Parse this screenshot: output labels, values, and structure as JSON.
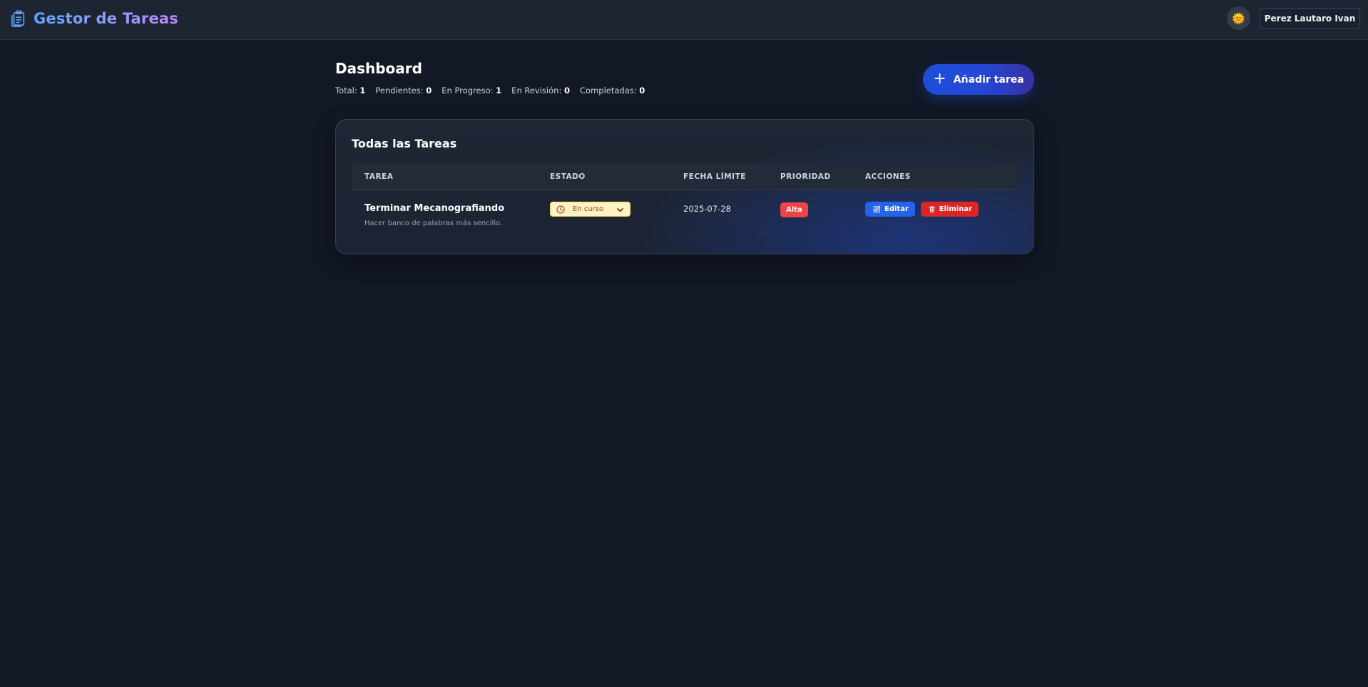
{
  "header": {
    "title": "Gestor de Tareas",
    "brand_icon": "clipboard-icon",
    "theme_icon": "sun-icon",
    "theme_glyph": "🌞",
    "user_name": "Perez Lautaro Ivan"
  },
  "dashboard": {
    "title": "Dashboard",
    "stats": [
      {
        "label": "Total:",
        "value": "1"
      },
      {
        "label": "Pendientes:",
        "value": "0"
      },
      {
        "label": "En Progreso:",
        "value": "1"
      },
      {
        "label": "En Revisión:",
        "value": "0"
      },
      {
        "label": "Completadas:",
        "value": "0"
      }
    ],
    "add_button": {
      "label": "Añadir tarea",
      "icon": "plus-icon",
      "glyph": "+"
    }
  },
  "tasks_table": {
    "title": "Todas las Tareas",
    "columns": [
      "TAREA",
      "ESTADO",
      "FECHA LÍMITE",
      "PRIORIDAD",
      "ACCIONES"
    ],
    "rows": [
      {
        "title": "Terminar Mecanografiando",
        "description": "Hacer banco de palabras más sencillo.",
        "status": "En curso",
        "due_date": "2025-07-28",
        "priority": "Alta",
        "edit_label": "Editar",
        "delete_label": "Eliminar"
      }
    ]
  },
  "colors": {
    "background": "#121826",
    "header": "#1e2532",
    "accent": "#1d4ed8",
    "status_bg": "#fef3c7",
    "priority_high": "#ef4444",
    "edit": "#2563eb",
    "delete": "#dc2626"
  }
}
